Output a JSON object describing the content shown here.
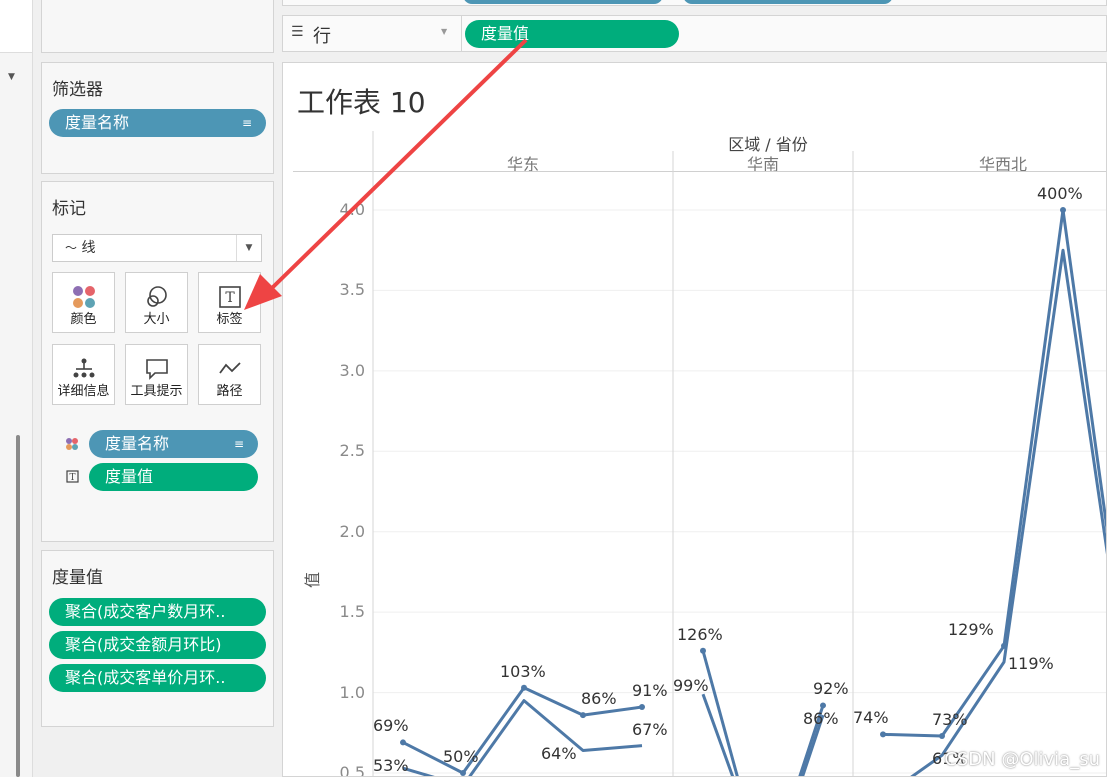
{
  "shelf": {
    "rows_label": "行",
    "rows_pill": "度量值"
  },
  "filters": {
    "title": "筛选器",
    "pill": "度量名称"
  },
  "marks": {
    "title": "标记",
    "mark_type": "线",
    "buttons": [
      {
        "label": "颜色",
        "icon": "color-icon"
      },
      {
        "label": "大小",
        "icon": "size-icon"
      },
      {
        "label": "标签",
        "icon": "label-icon"
      },
      {
        "label": "详细信息",
        "icon": "detail-icon"
      },
      {
        "label": "工具提示",
        "icon": "tooltip-icon"
      },
      {
        "label": "路径",
        "icon": "path-icon"
      }
    ],
    "fields": [
      {
        "label": "度量名称",
        "icon": "color-icon"
      },
      {
        "label": "度量值",
        "icon": "label-icon"
      }
    ]
  },
  "measure_values": {
    "title": "度量值",
    "items": [
      "聚合(成交客户数月环..",
      "聚合(成交金额月环比)",
      "聚合(成交客单价月环.."
    ]
  },
  "worksheet": {
    "title": "工作表 10",
    "header": "区域 / 省份",
    "regions": [
      "华东",
      "华南",
      "华西北"
    ],
    "y_axis_label": "值",
    "y_ticks": [
      "4.0",
      "3.5",
      "3.0",
      "2.5",
      "2.0",
      "1.5",
      "1.0",
      "0.5"
    ]
  },
  "annotation": {
    "color": "#ee4444"
  },
  "colors": {
    "line": "#4e79a7",
    "blue_pill": "#4d96b5",
    "green_pill": "#00ad7c"
  },
  "chart_data": {
    "type": "line",
    "ylabel": "值",
    "ylim": [
      0.4,
      4.3
    ],
    "panels": [
      {
        "region": "华东",
        "series": [
          {
            "values": [
              0.69,
              0.5,
              1.03,
              0.86,
              0.91
            ],
            "labels": [
              "69%",
              "50%",
              "103%",
              "86%",
              "91%"
            ]
          },
          {
            "values": [
              0.53,
              0.42,
              0.95,
              0.64,
              0.67
            ],
            "labels": [
              "53%",
              "",
              "",
              "64%",
              "67%"
            ]
          }
        ]
      },
      {
        "region": "华南",
        "series": [
          {
            "values": [
              1.26,
              0.35,
              0.35,
              0.92
            ],
            "labels": [
              "126%",
              "",
              "",
              "92%"
            ]
          },
          {
            "values": [
              0.99,
              0.3,
              0.3,
              0.86
            ],
            "labels": [
              "99%",
              "",
              "",
              "86%"
            ]
          }
        ]
      },
      {
        "region": "华西北",
        "series": [
          {
            "values": [
              0.74,
              0.73,
              1.29,
              4.0,
              1.3
            ],
            "labels": [
              "74%",
              "73%",
              "129%",
              "400%",
              ""
            ]
          },
          {
            "values": [
              0.35,
              0.61,
              1.19,
              3.75,
              1.2
            ],
            "labels": [
              "",
              "61%",
              "119%",
              "",
              ""
            ]
          }
        ]
      }
    ]
  },
  "watermark": "CSDN @Olivia_su"
}
